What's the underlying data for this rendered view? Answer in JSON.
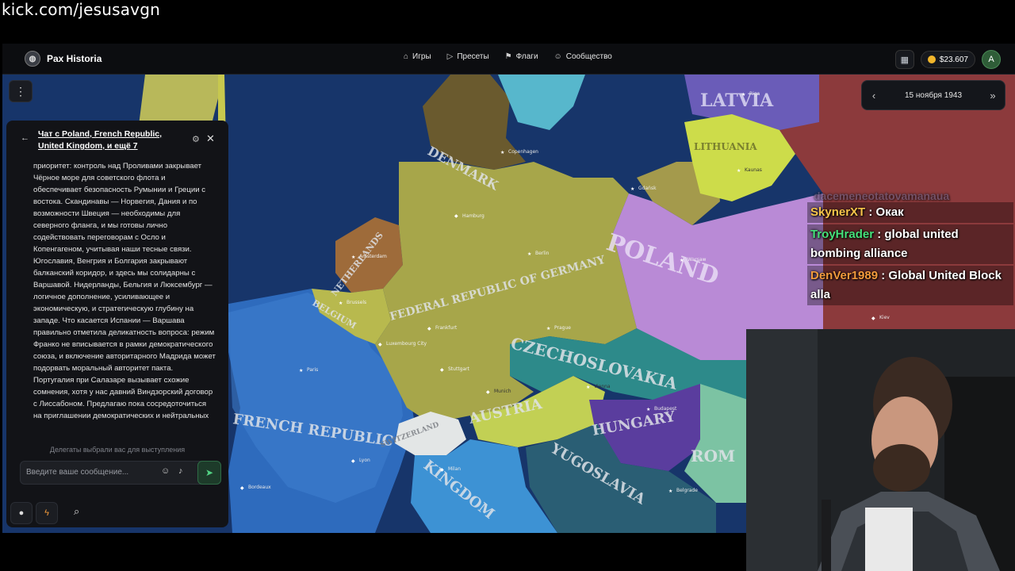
{
  "stream": {
    "url": "kick.com/jesusavgn"
  },
  "navbar": {
    "brand": "Pax Historia",
    "links": [
      {
        "label": "Игры",
        "icon": "gamepad-icon"
      },
      {
        "label": "Пресеты",
        "icon": "play-icon"
      },
      {
        "label": "Флаги",
        "icon": "flag-icon"
      },
      {
        "label": "Сообщество",
        "icon": "users-icon"
      }
    ],
    "balance": "$23.607",
    "avatar": "A"
  },
  "date_panel": {
    "date": "15 ноября 1943",
    "prev_icon": "chevron-left-icon",
    "next_icon": "double-chevron-right-icon"
  },
  "chat": {
    "back_icon": "arrow-left-icon",
    "title": "Чат с Poland, French Republic, United Kingdom, и ещё 7",
    "message": "приоритет: контроль над Проливами закрывает Чёрное море для советского флота и обеспечивает безопасность Румынии и Греции с востока. Скандинавы — Норвегия, Дания и по возможности Швеция — необходимы для северного фланга, и мы готовы лично содействовать переговорам с Осло и Копенгагеном, учитывая наши тесные связи. Югославия, Венгрия и Болгария закрывают балканский коридор, и здесь мы солидарны с Варшавой. Нидерланды, Бельгия и Люксембург — логичное дополнение, усиливающее и экономическую, и стратегическую глубину на западе. Что касается Испании — Варшава правильно отметила деликатность вопроса: режим Франко не вписывается в рамки демократического союза, и включение авторитарного Мадрида может подорвать моральный авторитет пакта. Португалия при Салазаре вызывает схожие сомнения, хотя у нас давний Виндзорский договор с Лиссабоном. Предлагаю пока сосредоточиться на приглашении демократических и нейтральных",
    "status": "Делегаты выбрали вас для выступления",
    "input_placeholder": "Введите ваше сообщение..."
  },
  "map": {
    "labels": [
      "DENMARK",
      "LATVIA",
      "LITHUANIA",
      "NETHERLANDS",
      "BELGIUM",
      "FEDERAL REPUBLIC OF GERMANY",
      "POLAND",
      "CZECHOSLOVAKIA",
      "AUSTRIA",
      "HUNGARY",
      "FRENCH REPUBLIC",
      "SWITZERLAND",
      "KINGDOM",
      "YUGOSLAVIA",
      "ROM"
    ],
    "cities": [
      "Copenhagen",
      "Riga",
      "Kaunas",
      "Gdańsk",
      "Hamburg",
      "Berlin",
      "Amsterdam",
      "Brussels",
      "Warsaw",
      "Prague",
      "Vienna",
      "Budapest",
      "Paris",
      "Munich",
      "Frankfurt",
      "Stuttgart",
      "Luxembourg City",
      "Lyon",
      "Bordeaux",
      "Milan",
      "Belgrade",
      "Kiev"
    ]
  },
  "stream_chat": {
    "cutoff_user": "dacemeneotatovamanaua",
    "messages": [
      {
        "user": "SkynerXT",
        "text": "Окак"
      },
      {
        "user": "TroyHrader",
        "text": "global united bombing alliance"
      },
      {
        "user": "DenVer1989",
        "text": "Global United Block alla"
      }
    ]
  },
  "colors": {
    "sea": "#17356a",
    "germany": "#a7a64a",
    "poland": "#b98ad6",
    "czechoslovakia": "#2d8a8a",
    "austria": "#c2d054",
    "hungary": "#5a3d9e",
    "france": "#2e6bbd",
    "lithuania": "#cddc4a",
    "latvia": "#6a5cb8",
    "send_accent": "#52d284"
  }
}
